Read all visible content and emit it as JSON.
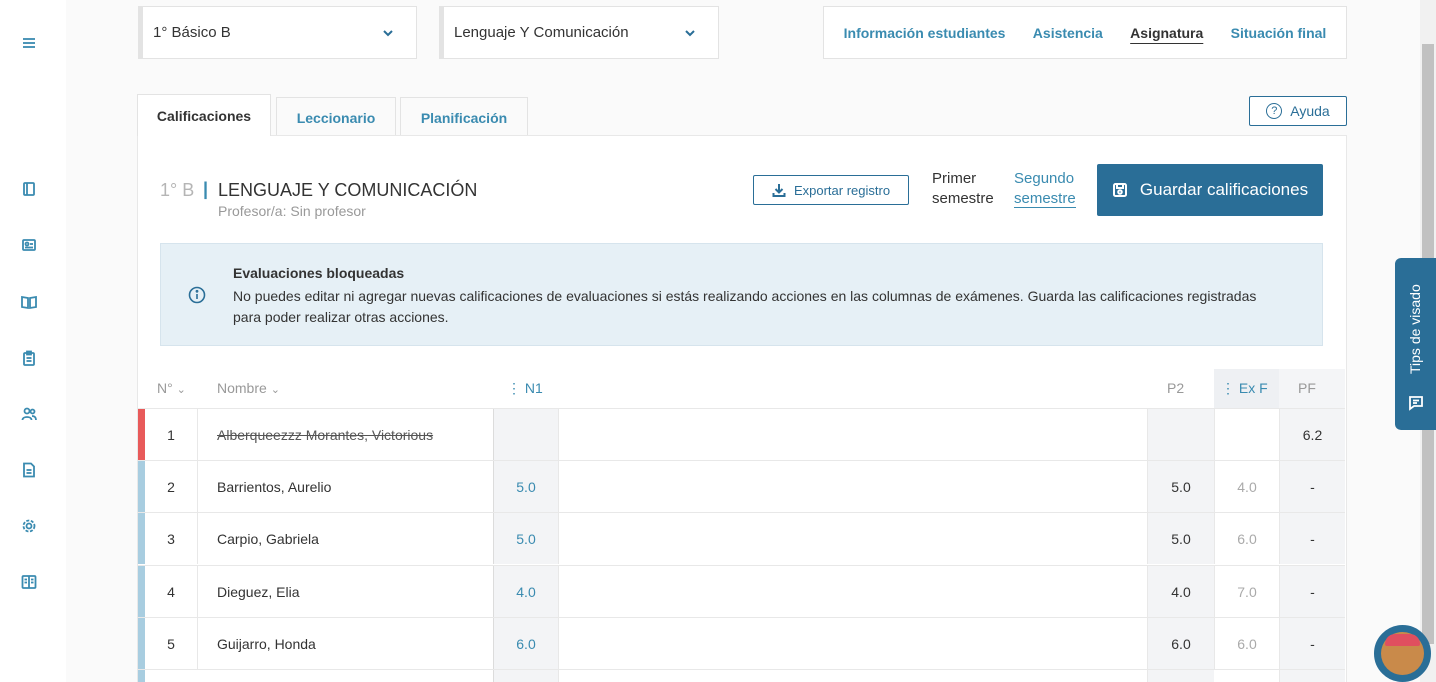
{
  "selects": {
    "course": "1° Básico B",
    "subject": "Lenguaje Y Comunicación"
  },
  "topnav": {
    "items": [
      "Información estudiantes",
      "Asistencia",
      "Asignatura",
      "Situación final"
    ],
    "active": "Asignatura"
  },
  "tabs": [
    "Calificaciones",
    "Leccionario",
    "Planificación"
  ],
  "help_label": "Ayuda",
  "course_header": {
    "code": "1° B",
    "separator": "|",
    "title": "LENGUAJE Y COMUNICACIÓN",
    "teacher": "Profesor/a: Sin profesor"
  },
  "actions": {
    "export_label": "Exportar registro",
    "semester_first_line1": "Primer",
    "semester_first_line2": "semestre",
    "semester_second_line1": "Segundo",
    "semester_second_line2": "semestre",
    "save_label": "Guardar calificaciones"
  },
  "alert": {
    "title": "Evaluaciones bloqueadas",
    "body": "No puedes editar ni agregar nuevas calificaciones de evaluaciones si estás realizando acciones en las columnas de exámenes. Guarda las calificaciones registradas para poder realizar otras acciones."
  },
  "table": {
    "headers": {
      "num": "N°",
      "name": "Nombre",
      "n1": "N1",
      "p2": "P2",
      "exf": "Ex F",
      "pf": "PF"
    },
    "rows": [
      {
        "num": "1",
        "name": "Alberqueezzz Morantes, Victorious",
        "n1": "",
        "p2": "",
        "exf": "",
        "pf": "6.2",
        "withdrawn": true
      },
      {
        "num": "2",
        "name": "Barrientos, Aurelio",
        "n1": "5.0",
        "p2": "5.0",
        "exf": "4.0",
        "pf": "-",
        "withdrawn": false
      },
      {
        "num": "3",
        "name": "Carpio, Gabriela",
        "n1": "5.0",
        "p2": "5.0",
        "exf": "6.0",
        "pf": "-",
        "withdrawn": false
      },
      {
        "num": "4",
        "name": "Dieguez, Elia",
        "n1": "4.0",
        "p2": "4.0",
        "exf": "7.0",
        "pf": "-",
        "withdrawn": false
      },
      {
        "num": "5",
        "name": "Guijarro, Honda",
        "n1": "6.0",
        "p2": "6.0",
        "exf": "6.0",
        "pf": "-",
        "withdrawn": false
      }
    ]
  },
  "tips_label": "Tips de visado",
  "colors": {
    "primary": "#2a6e97",
    "link": "#3a8bb0",
    "withdrawn_bar": "#e85a5a",
    "active_bar": "#a8cde0",
    "alert_bg": "#e6f0f6"
  },
  "icons": {
    "sidebar": [
      "menu-icon",
      "book-icon",
      "id-card-icon",
      "open-book-icon",
      "clipboard-icon",
      "users-icon",
      "document-icon",
      "gear-icon",
      "manual-icon"
    ]
  }
}
